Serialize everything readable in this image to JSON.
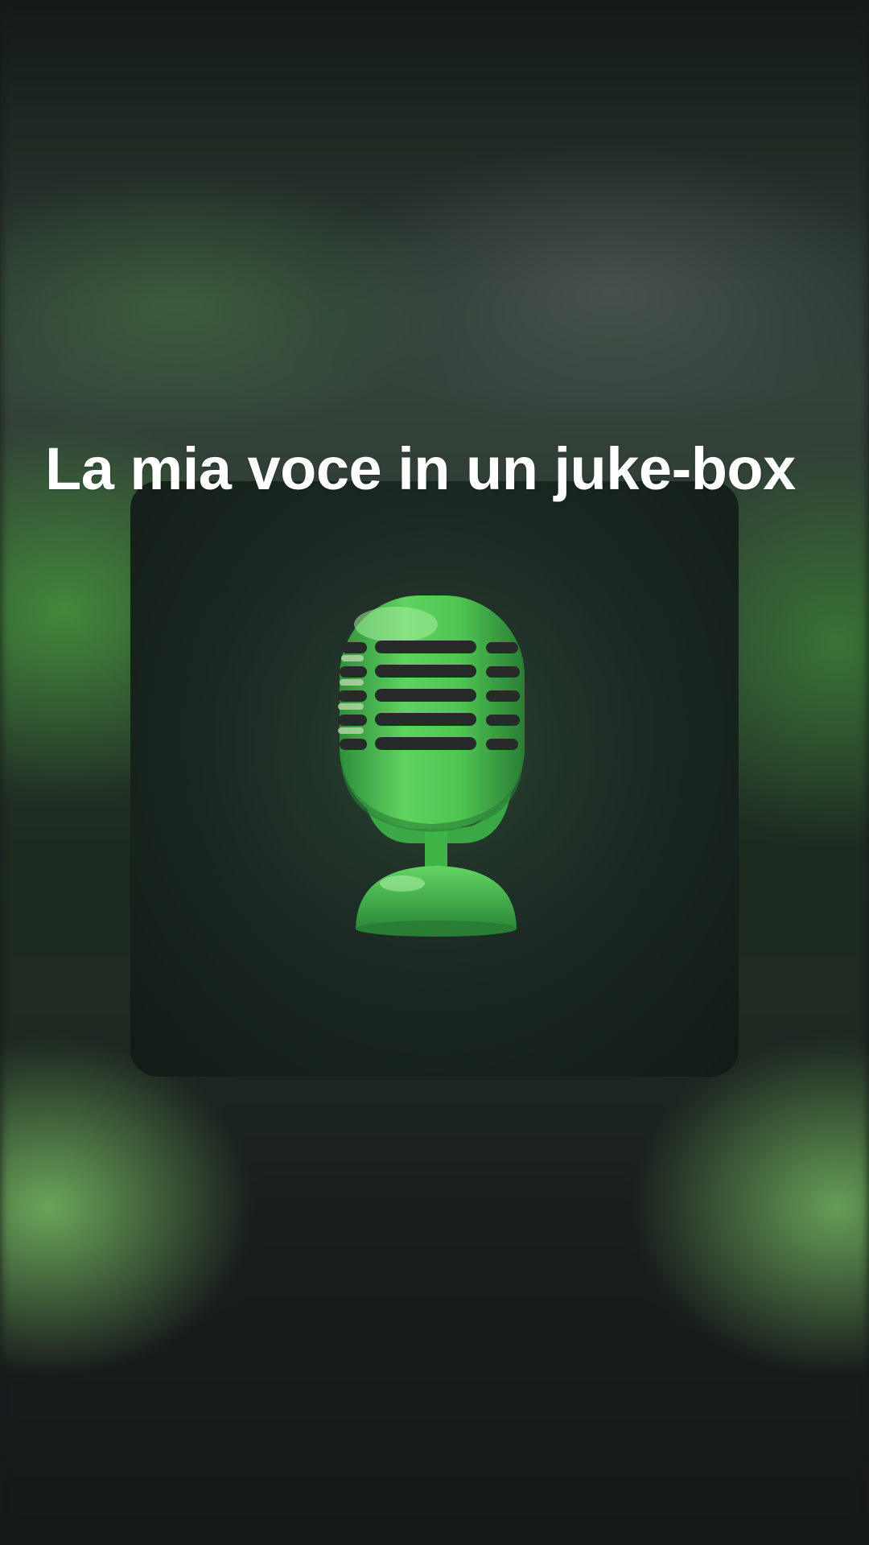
{
  "post": {
    "title": "La mia voce in un juke-box"
  },
  "cover": {
    "icon": "microphone-icon"
  },
  "colors": {
    "accent": "#4cc24f",
    "background": "#161a19",
    "text": "#ffffff"
  }
}
